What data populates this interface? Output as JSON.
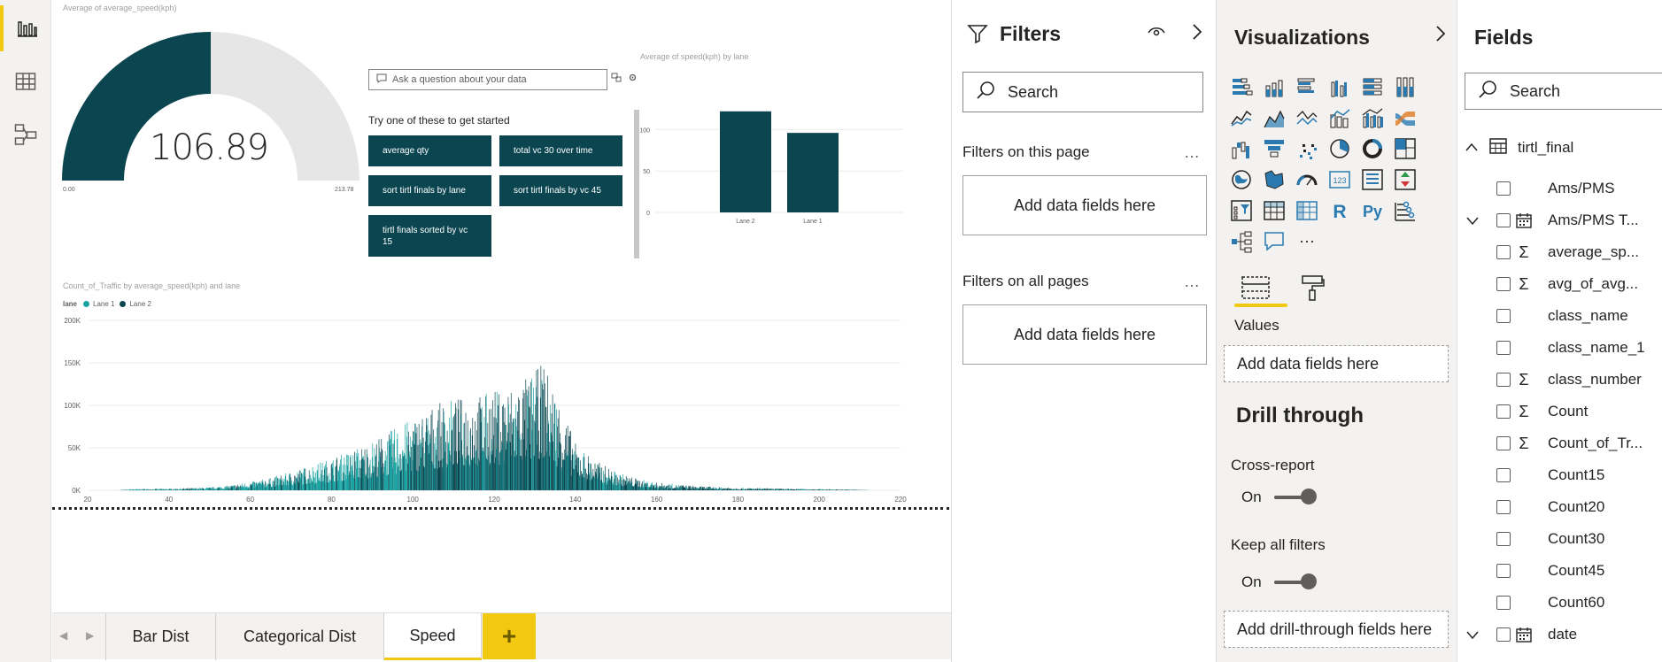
{
  "rail": {
    "items": [
      {
        "name": "report-view",
        "active": true
      },
      {
        "name": "data-view",
        "active": false
      },
      {
        "name": "model-view",
        "active": false
      }
    ]
  },
  "gauge": {
    "title": "Average of average_speed(kph)",
    "value_label": "106.89",
    "min_label": "0.00",
    "max_label": "213.78",
    "value": 106.89,
    "min": 0,
    "max": 213.78,
    "fill_color": "#0b4650",
    "track_color": "#e6e6e6"
  },
  "qa": {
    "placeholder": "Ask a question about your data",
    "hint": "Try one of these to get started",
    "suggestions": [
      "average qty",
      "total vc 30 over time",
      "sort tirtl finals by lane",
      "sort tirtl finals by vc 45",
      "tirtl finals sorted by vc 15"
    ]
  },
  "chart_data": [
    {
      "type": "bar",
      "title": "Average of speed(kph) by lane",
      "categories": [
        "Lane 2",
        "Lane 1"
      ],
      "values": [
        122,
        96
      ],
      "yticks": [
        "100",
        "50",
        "0"
      ],
      "ylim": [
        0,
        125
      ],
      "color": "#0b4650"
    },
    {
      "type": "bar",
      "title": "Count_of_Traffic by average_speed(kph) and lane",
      "legend_title": "lane",
      "series": [
        {
          "name": "Lane 1",
          "color": "#1aa3a3"
        },
        {
          "name": "Lane 2",
          "color": "#0b4650"
        }
      ],
      "x_ticks": [
        "20",
        "40",
        "60",
        "80",
        "100",
        "120",
        "140",
        "160",
        "180",
        "200",
        "220"
      ],
      "y_ticks": [
        "200K",
        "150K",
        "100K",
        "50K",
        "0K"
      ],
      "xlim": [
        20,
        220
      ],
      "ylim": [
        0,
        200000
      ],
      "profile": [
        [
          30,
          1500
        ],
        [
          40,
          2000
        ],
        [
          50,
          3500
        ],
        [
          55,
          6000
        ],
        [
          60,
          10000
        ],
        [
          65,
          15000
        ],
        [
          70,
          22000
        ],
        [
          75,
          30000
        ],
        [
          80,
          38000
        ],
        [
          85,
          48000
        ],
        [
          90,
          58000
        ],
        [
          95,
          72000
        ],
        [
          100,
          85000
        ],
        [
          105,
          100000
        ],
        [
          110,
          108000
        ],
        [
          115,
          112000
        ],
        [
          120,
          118000
        ],
        [
          125,
          125000
        ],
        [
          130,
          140000
        ],
        [
          132,
          152000
        ],
        [
          135,
          118000
        ],
        [
          138,
          82000
        ],
        [
          140,
          55000
        ],
        [
          145,
          35000
        ],
        [
          150,
          22000
        ],
        [
          155,
          14000
        ],
        [
          160,
          9000
        ],
        [
          170,
          5000
        ],
        [
          180,
          3000
        ],
        [
          200,
          1500
        ],
        [
          210,
          800
        ]
      ]
    }
  ],
  "tabs": {
    "items": [
      "Bar Dist",
      "Categorical Dist",
      "Speed"
    ],
    "active": "Speed",
    "add_label": "+"
  },
  "filters": {
    "title": "Filters",
    "search_placeholder": "Search",
    "on_this_page": "Filters on this page",
    "on_all_pages": "Filters on all pages",
    "drop_label": "Add data fields here",
    "more": "…"
  },
  "visualizations": {
    "title": "Visualizations",
    "values_label": "Values",
    "values_drop": "Add data fields here",
    "drill_title": "Drill through",
    "cross_report_label": "Cross-report",
    "cross_report_state": "On",
    "keep_filters_label": "Keep all filters",
    "keep_filters_state": "On",
    "drill_drop": "Add drill-through fields here",
    "r_label": "R",
    "py_label": "Py",
    "more": "···"
  },
  "fields": {
    "title": "Fields",
    "search_placeholder": "Search",
    "table_name": "tirtl_final",
    "items": [
      {
        "label": "Ams/PMS",
        "kind": "plain"
      },
      {
        "label": "Ams/PMS T...",
        "kind": "date"
      },
      {
        "label": "average_sp...",
        "kind": "sigma"
      },
      {
        "label": "avg_of_avg...",
        "kind": "sigma"
      },
      {
        "label": "class_name",
        "kind": "plain"
      },
      {
        "label": "class_name_1",
        "kind": "plain"
      },
      {
        "label": "class_number",
        "kind": "sigma"
      },
      {
        "label": "Count",
        "kind": "sigma"
      },
      {
        "label": "Count_of_Tr...",
        "kind": "sigma"
      },
      {
        "label": "Count15",
        "kind": "plain"
      },
      {
        "label": "Count20",
        "kind": "plain"
      },
      {
        "label": "Count30",
        "kind": "plain"
      },
      {
        "label": "Count45",
        "kind": "plain"
      },
      {
        "label": "Count60",
        "kind": "plain"
      },
      {
        "label": "date",
        "kind": "date"
      }
    ]
  }
}
